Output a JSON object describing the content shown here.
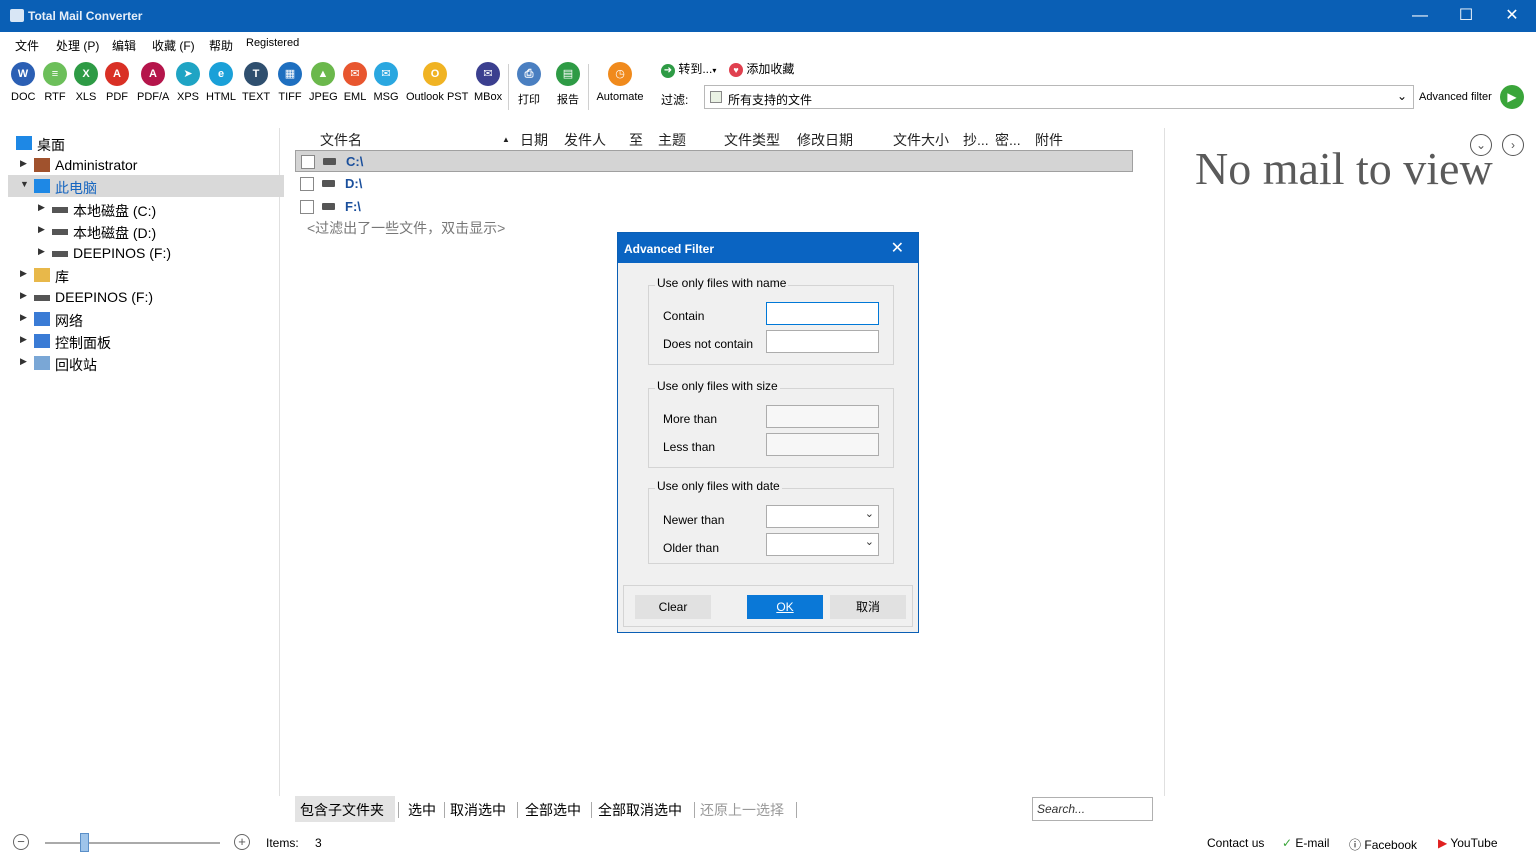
{
  "window": {
    "title": "Total Mail Converter",
    "minimize": "—",
    "maximize": "☐",
    "close": "✕"
  },
  "menu": [
    "文件",
    "处理 (P)",
    "编辑",
    "收藏 (F)",
    "帮助",
    "Registered"
  ],
  "toolbar": {
    "formats": [
      {
        "label": "DOC",
        "icon": "W",
        "color": "#2b5fb4"
      },
      {
        "label": "RTF",
        "icon": "≡",
        "color": "#6cbf5a"
      },
      {
        "label": "XLS",
        "icon": "X",
        "color": "#2e9b45"
      },
      {
        "label": "PDF",
        "icon": "A",
        "color": "#d93025"
      },
      {
        "label": "PDF/A",
        "icon": "A",
        "color": "#b5154b"
      },
      {
        "label": "XPS",
        "icon": "➤",
        "color": "#1fa4c4"
      },
      {
        "label": "HTML",
        "icon": "e",
        "color": "#1aa0d8"
      },
      {
        "label": "TEXT",
        "icon": "T",
        "color": "#2f4f6f"
      },
      {
        "label": "TIFF",
        "icon": "▦",
        "color": "#1e6fc0"
      },
      {
        "label": "JPEG",
        "icon": "▲",
        "color": "#6bb84c"
      },
      {
        "label": "EML",
        "icon": "✉",
        "color": "#e8562f"
      },
      {
        "label": "MSG",
        "icon": "✉",
        "color": "#2aa7e0"
      },
      {
        "label": "Outlook PST",
        "icon": "O",
        "color": "#f0b323"
      },
      {
        "label": "MBox",
        "icon": "✉",
        "color": "#3b3f8f"
      }
    ],
    "print": {
      "label": "打印",
      "icon": "⎙",
      "color": "#4a7fc1"
    },
    "report": {
      "label": "报告",
      "icon": "▤",
      "color": "#2e9b45"
    },
    "automate": {
      "label": "Automate",
      "icon": "◷",
      "color": "#f08a1c"
    },
    "goto": "转到...",
    "add_favorite": "添加收藏",
    "filter_label": "过滤:",
    "filter_value": "所有支持的文件",
    "advanced_filter": "Advanced filter"
  },
  "tree": [
    {
      "label": "桌面",
      "icon": "desktop-icon",
      "color": "#1e88e5"
    },
    {
      "label": "Administrator",
      "icon": "user-icon",
      "color": "#a0522d"
    },
    {
      "label": "此电脑",
      "icon": "computer-icon",
      "color": "#1e88e5"
    },
    {
      "label": "本地磁盘 (C:)",
      "icon": "drive-icon",
      "color": "#555555"
    },
    {
      "label": "本地磁盘 (D:)",
      "icon": "drive-icon",
      "color": "#555555"
    },
    {
      "label": "DEEPINOS (F:)",
      "icon": "drive-icon",
      "color": "#555555"
    },
    {
      "label": "库",
      "icon": "library-icon",
      "color": "#e8b84a"
    },
    {
      "label": "DEEPINOS (F:)",
      "icon": "drive-icon",
      "color": "#555555"
    },
    {
      "label": "网络",
      "icon": "network-icon",
      "color": "#3a7bd5"
    },
    {
      "label": "控制面板",
      "icon": "control-panel-icon",
      "color": "#3a7bd5"
    },
    {
      "label": "回收站",
      "icon": "recycle-bin-icon",
      "color": "#7aa7d6"
    }
  ],
  "columns": [
    "文件名",
    "日期",
    "发件人",
    "至",
    "主题",
    "文件类型",
    "修改日期",
    "文件大小",
    "抄...",
    "密...",
    "附件"
  ],
  "files": [
    "C:\\",
    "D:\\",
    "F:\\"
  ],
  "filtered_note": "<过滤出了一些文件，双击显示>",
  "preview": {
    "empty_text": "No mail to view",
    "down": "⌄",
    "next": "›"
  },
  "bottom_actions": [
    "包含子文件夹",
    "选中",
    "取消选中",
    "全部选中",
    "全部取消选中",
    "还原上一选择"
  ],
  "search_placeholder": "Search...",
  "status": {
    "items_label": "Items:",
    "items_count": "3",
    "contact": "Contact us",
    "email": "E-mail",
    "facebook": "Facebook",
    "youtube": "YouTube",
    "zoom_level": 0.22
  },
  "dialog": {
    "title": "Advanced Filter",
    "close": "✕",
    "group_name": "Use only files with name",
    "contain": "Contain",
    "not_contain": "Does not contain",
    "group_size": "Use only files with size",
    "more_than": "More than",
    "less_than": "Less than",
    "group_date": "Use only files with date",
    "newer_than": "Newer than",
    "older_than": "Older than",
    "btn_clear": "Clear",
    "btn_ok": "OK",
    "btn_cancel": "取消"
  }
}
